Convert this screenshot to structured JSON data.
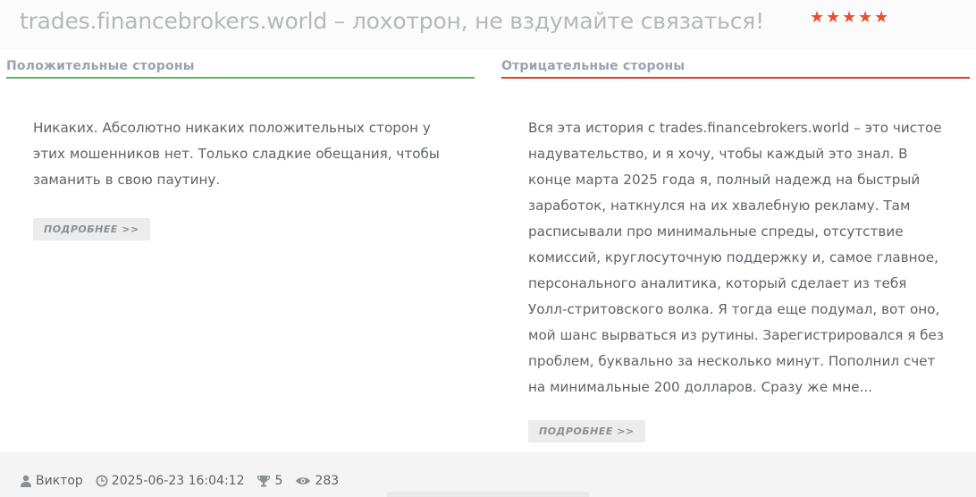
{
  "header": {
    "title": "trades.financebrokers.world – лохотрон, не вздумайте связаться!",
    "rating_stars": 5,
    "star_glyph": "★",
    "star_color": "#e8512c"
  },
  "positive": {
    "heading": "Положительные стороны",
    "accent_color": "#5cb85c",
    "text": "Никаких. Абсолютно никаких положительных сторон у этих мошенников нет. Только сладкие обещания, чтобы заманить в свою паутину.",
    "more_label": "ПОДРОБНЕЕ >>"
  },
  "negative": {
    "heading": "Отрицательные стороны",
    "accent_color": "#d9432b",
    "text": "Вся эта история с trades.financebrokers.world – это чистое надувательство, и я хочу, чтобы каждый это знал. В конце марта 2025 года я, полный надежд на быстрый заработок, наткнулся на их хвалебную рекламу. Там расписывали про минимальные спреды, отсутствие комиссий, круглосуточную поддержку и, самое главное, персонального аналитика, который сделает из тебя Уолл-стритовского волка. Я тогда еще подумал, вот оно, мой шанс вырваться из рутины. Зарегистрировался я без проблем, буквально за несколько минут. Пополнил счет на минимальные 200 долларов. Сразу же мне...",
    "more_label": "ПОДРОБНЕЕ >>"
  },
  "footer": {
    "author": "Виктор",
    "author_icon": "user-icon",
    "datetime": "2025-06-23 16:04:12",
    "datetime_icon": "clock-icon",
    "trophies": "5",
    "trophy_icon": "trophy-icon",
    "views": "283",
    "views_icon": "eye-icon"
  }
}
